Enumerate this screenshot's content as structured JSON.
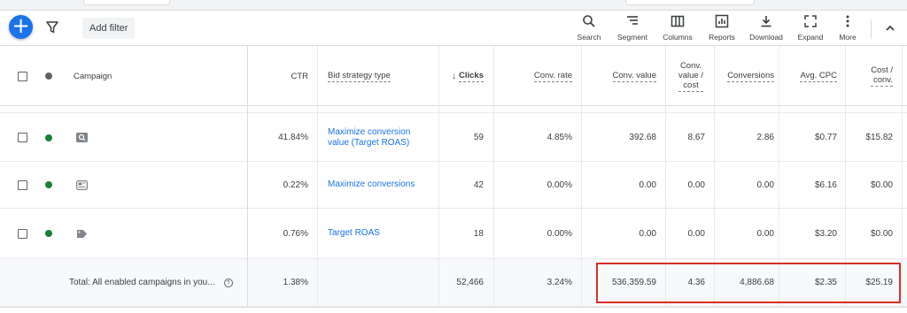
{
  "toolbar": {
    "add_filter": "Add filter",
    "tools": [
      {
        "label": "Search",
        "icon": "search-icon"
      },
      {
        "label": "Segment",
        "icon": "segment-icon"
      },
      {
        "label": "Columns",
        "icon": "columns-icon"
      },
      {
        "label": "Reports",
        "icon": "reports-icon"
      },
      {
        "label": "Download",
        "icon": "download-icon"
      },
      {
        "label": "Expand",
        "icon": "expand-icon"
      },
      {
        "label": "More",
        "icon": "more-vert-icon"
      }
    ]
  },
  "table": {
    "headers": {
      "campaign": "Campaign",
      "ctr": "CTR",
      "bid_strategy": "Bid strategy type",
      "clicks": "Clicks",
      "conv_rate": "Conv. rate",
      "conv_value": "Conv. value",
      "conv_value_cost_1": "Conv.",
      "conv_value_cost_2": "value /",
      "conv_value_cost_3": "cost",
      "conversions": "Conversions",
      "avg_cpc": "Avg. CPC",
      "cost_conv_1": "Cost /",
      "cost_conv_2": "conv."
    },
    "rows": [
      {
        "status": "enabled",
        "type_icon": "search-campaign-icon",
        "ctr": "41.84%",
        "bid_strategy_1": "Maximize conversion",
        "bid_strategy_2": "value (Target ROAS)",
        "clicks": "59",
        "conv_rate": "4.85%",
        "conv_value": "392.68",
        "conv_value_cost": "8.67",
        "conversions": "2.86",
        "avg_cpc": "$0.77",
        "cost_conv": "$15.82"
      },
      {
        "status": "enabled",
        "type_icon": "display-campaign-icon",
        "ctr": "0.22%",
        "bid_strategy_1": "Maximize conversions",
        "bid_strategy_2": "",
        "clicks": "42",
        "conv_rate": "0.00%",
        "conv_value": "0.00",
        "conv_value_cost": "0.00",
        "conversions": "0.00",
        "avg_cpc": "$6.16",
        "cost_conv": "$0.00"
      },
      {
        "status": "enabled",
        "type_icon": "shopping-campaign-icon",
        "ctr": "0.76%",
        "bid_strategy_1": "Target ROAS",
        "bid_strategy_2": "",
        "clicks": "18",
        "conv_rate": "0.00%",
        "conv_value": "0.00",
        "conv_value_cost": "0.00",
        "conversions": "0.00",
        "avg_cpc": "$3.20",
        "cost_conv": "$0.00"
      }
    ],
    "total": {
      "label": "Total: All enabled campaigns in you...",
      "help": "?",
      "ctr": "1.38%",
      "clicks": "52,466",
      "conv_rate": "3.24%",
      "conv_value": "536,359.59",
      "conv_value_cost": "4.36",
      "conversions": "4,886.68",
      "avg_cpc": "$2.35",
      "cost_conv": "$25.19"
    }
  },
  "colors": {
    "accent": "#1a73e8",
    "enabled_dot": "#188038",
    "highlight": "#d93025"
  }
}
